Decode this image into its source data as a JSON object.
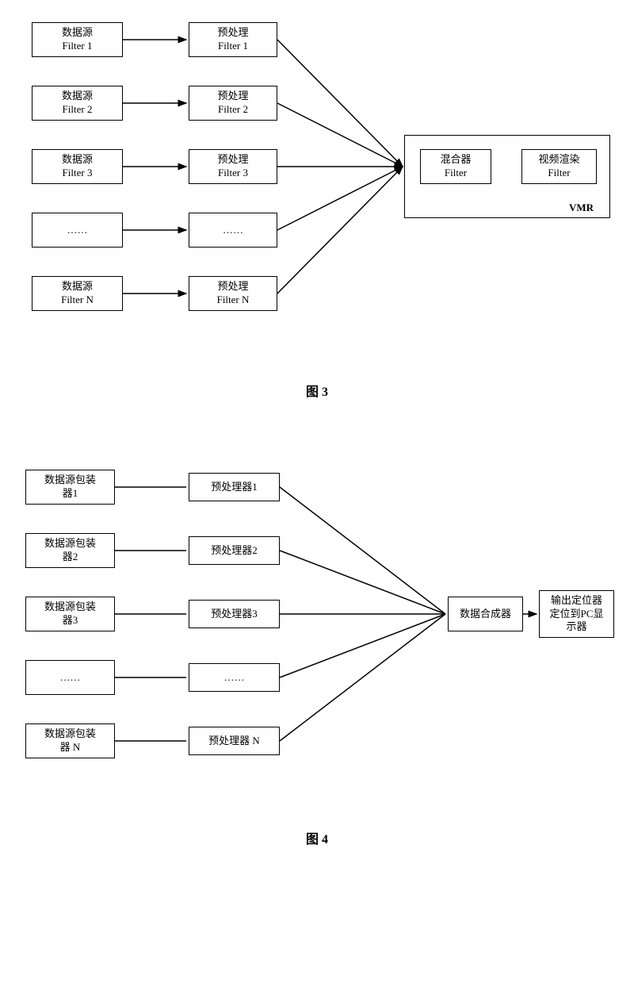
{
  "fig3": {
    "caption": "图 3",
    "sources": [
      {
        "l1": "数据源",
        "l2": "Filter 1"
      },
      {
        "l1": "数据源",
        "l2": "Filter 2"
      },
      {
        "l1": "数据源",
        "l2": "Filter 3"
      },
      {
        "l1": "……",
        "l2": ""
      },
      {
        "l1": "数据源",
        "l2": "Filter N"
      }
    ],
    "preprocs": [
      {
        "l1": "预处理",
        "l2": "Filter 1"
      },
      {
        "l1": "预处理",
        "l2": "Filter 2"
      },
      {
        "l1": "预处理",
        "l2": "Filter 3"
      },
      {
        "l1": "……",
        "l2": ""
      },
      {
        "l1": "预处理",
        "l2": "Filter N"
      }
    ],
    "mixer": {
      "l1": "混合器",
      "l2": "Filter"
    },
    "render": {
      "l1": "视频渲染",
      "l2": "Filter"
    },
    "vmr": "VMR"
  },
  "fig4": {
    "caption": "图 4",
    "sources": [
      {
        "l1": "数据源包装",
        "l2": "器1"
      },
      {
        "l1": "数据源包装",
        "l2": "器2"
      },
      {
        "l1": "数据源包装",
        "l2": "器3"
      },
      {
        "l1": "……",
        "l2": ""
      },
      {
        "l1": "数据源包装",
        "l2": "器 N"
      }
    ],
    "preprocs": [
      {
        "l1": "预处理器1"
      },
      {
        "l1": "预处理器2"
      },
      {
        "l1": "预处理器3"
      },
      {
        "l1": "……"
      },
      {
        "l1": "预处理器 N"
      }
    ],
    "combiner": "数据合成器",
    "output": {
      "l1": "输出定位器",
      "l2": "定位到PC显",
      "l3": "示器"
    }
  }
}
